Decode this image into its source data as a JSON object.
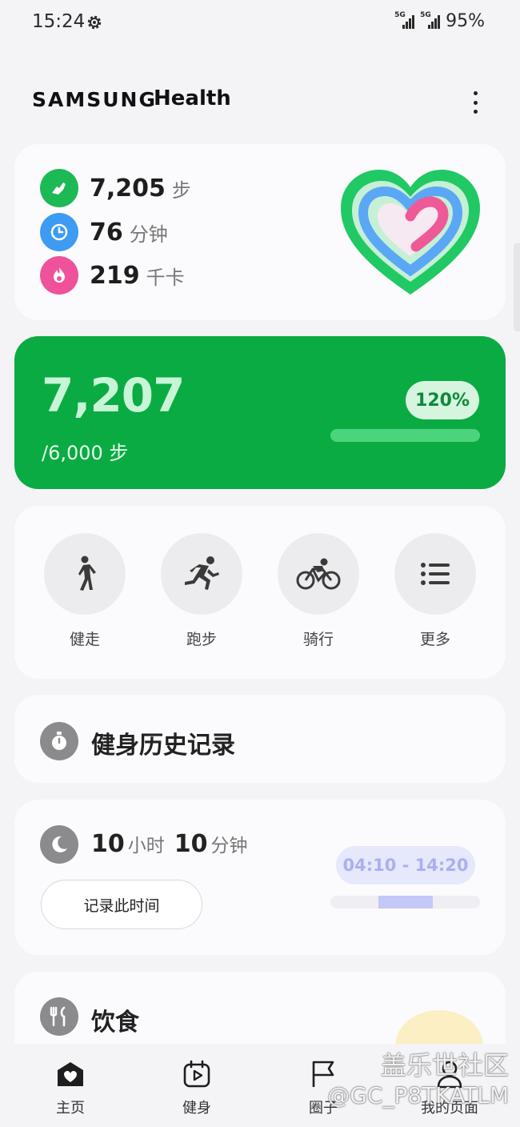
{
  "status_bar": {
    "time": "15:24",
    "network_1": "5G",
    "network_2": "5G",
    "battery": "95%"
  },
  "header": {
    "brand": "SAMSUNG",
    "app": "Health",
    "menu_icon": "more-vert-icon"
  },
  "summary": {
    "metrics": [
      {
        "value": "7,205",
        "unit": "步",
        "icon": "shoe-icon",
        "color": "#1db954"
      },
      {
        "value": "76",
        "unit": "分钟",
        "icon": "clock-icon",
        "color": "#3d9bf2"
      },
      {
        "value": "219",
        "unit": "千卡",
        "icon": "flame-icon",
        "color": "#f0519b"
      }
    ]
  },
  "steps_card": {
    "steps": "7,207",
    "goal": "/6,000 步",
    "percent_label": "120%",
    "progress_fraction": 1.0,
    "color": "#0aab43"
  },
  "workouts": [
    {
      "label": "健走",
      "icon": "walking-icon"
    },
    {
      "label": "跑步",
      "icon": "running-icon"
    },
    {
      "label": "骑行",
      "icon": "cycling-icon"
    },
    {
      "label": "更多",
      "icon": "list-icon"
    }
  ],
  "history": {
    "title": "健身历史记录",
    "icon": "stopwatch-icon"
  },
  "sleep": {
    "hours": "10",
    "hours_unit": "小时",
    "minutes": "10",
    "minutes_unit": "分钟",
    "button": "记录此时间",
    "range": "04:10 - 14:20",
    "icon": "moon-icon"
  },
  "food": {
    "title": "饮食",
    "icon": "fork-knife-icon"
  },
  "bottom_nav": [
    {
      "label": "主页",
      "icon": "home-heart-icon"
    },
    {
      "label": "健身",
      "icon": "calendar-play-icon"
    },
    {
      "label": "圈子",
      "icon": "flag-icon"
    },
    {
      "label": "我的页面",
      "icon": "person-icon"
    }
  ],
  "watermark": {
    "line1": "盖乐世社区",
    "line2": "@GC_P8TKATLM"
  }
}
